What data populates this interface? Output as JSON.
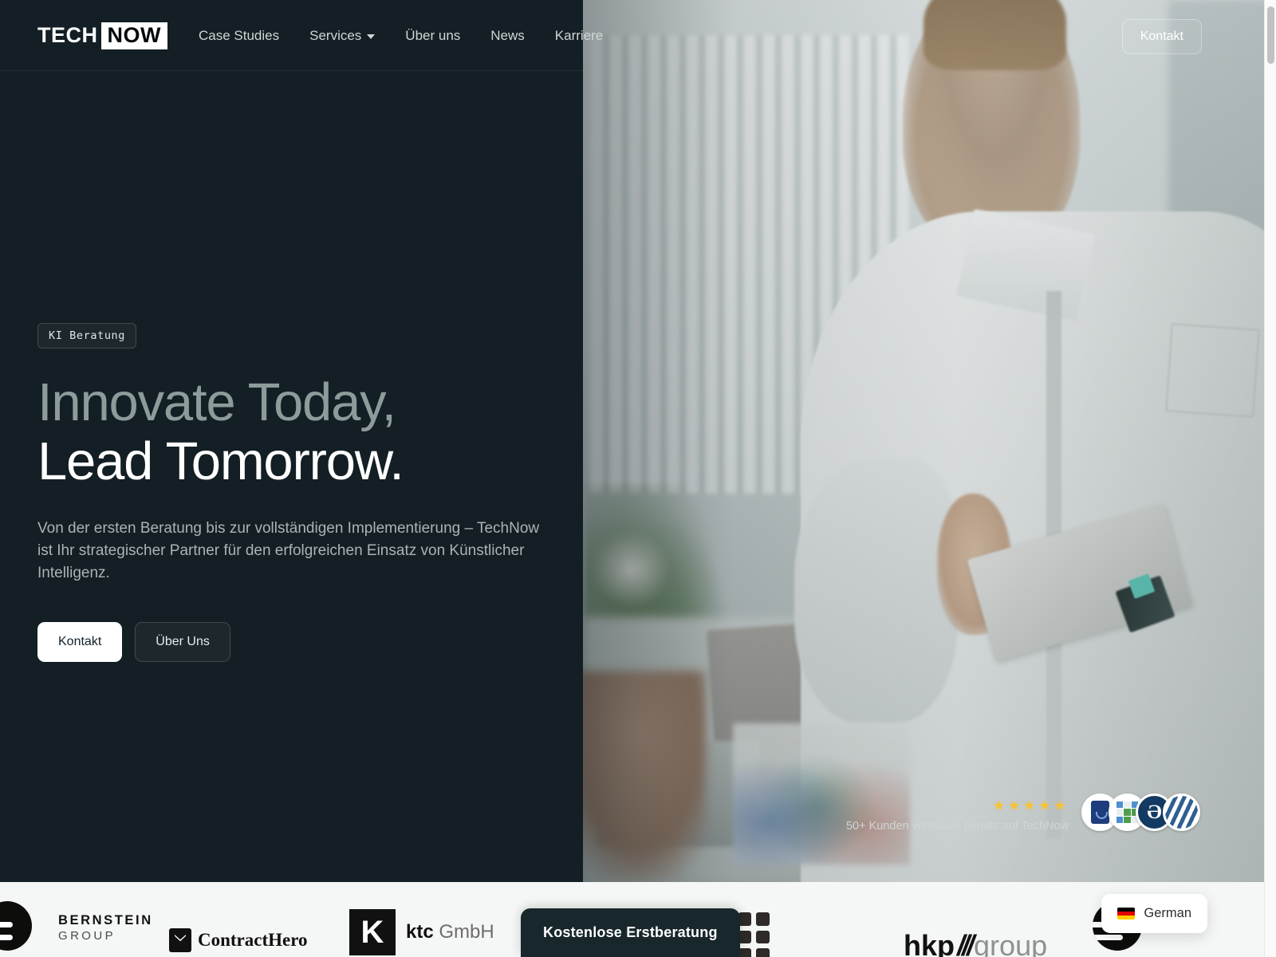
{
  "header": {
    "logo": {
      "part1": "TECH",
      "part2": "NOW"
    },
    "nav": [
      {
        "label": "Case Studies",
        "has_dropdown": false
      },
      {
        "label": "Services",
        "has_dropdown": true
      },
      {
        "label": "Über uns",
        "has_dropdown": false
      },
      {
        "label": "News",
        "has_dropdown": false
      },
      {
        "label": "Karriere",
        "has_dropdown": false
      }
    ],
    "contact_button": "Kontakt"
  },
  "hero": {
    "badge": "KI Beratung",
    "heading_line1": "Innovate Today,",
    "heading_line2": "Lead Tomorrow.",
    "paragraph": "Von der ersten Beratung bis zur vollständigen Implementierung – TechNow ist Ihr strategischer Partner für den erfolgreichen Einsatz von Künstlicher Intelligenz.",
    "primary_button": "Kontakt",
    "secondary_button": "Über Uns",
    "background_color": "#131f24"
  },
  "trust": {
    "stars": "★★★★★",
    "star_count": 5,
    "star_color": "#f4c436",
    "label": "50+ Kunden vertrauen bereits auf TechNow",
    "avatars": [
      {
        "name": "avatar-1"
      },
      {
        "name": "avatar-2"
      },
      {
        "name": "avatar-3",
        "letter": "Ə"
      },
      {
        "name": "avatar-4"
      }
    ]
  },
  "logobar": {
    "logos": [
      {
        "name": "sap-logo",
        "text": ""
      },
      {
        "name": "bernstein-group-logo",
        "line1": "BERNSTEIN",
        "line2": "GROUP"
      },
      {
        "name": "contracthero-logo",
        "text": "ContractHero"
      },
      {
        "name": "ktc-gmbh-logo",
        "mark": "K",
        "bold": "ktc",
        "light": " GmbH"
      },
      {
        "name": "grid-logo",
        "text": ""
      },
      {
        "name": "hkp-group-logo",
        "part1": "hkp",
        "slashes": "///",
        "part2": "group"
      },
      {
        "name": "sap-logo-2",
        "text": ""
      }
    ]
  },
  "floating_cta": {
    "label": "Kostenlose Erstberatung"
  },
  "language_selector": {
    "label": "German",
    "flag": "de"
  }
}
